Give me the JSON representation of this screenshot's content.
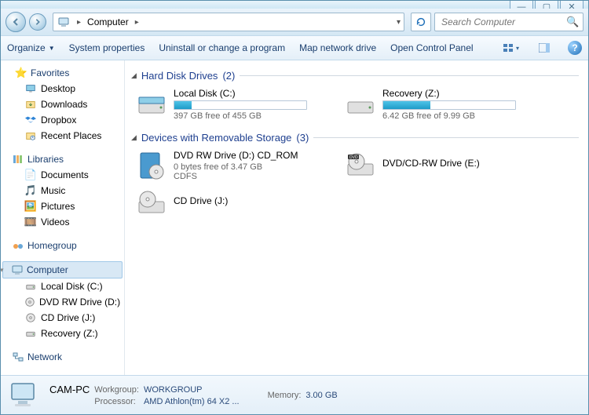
{
  "titlebar": {
    "min": "—",
    "max": "▢",
    "close": "✕"
  },
  "nav": {
    "location": "Computer",
    "search_placeholder": "Search Computer"
  },
  "toolbar": {
    "organize": "Organize",
    "sysprops": "System properties",
    "uninstall": "Uninstall or change a program",
    "mapdrive": "Map network drive",
    "controlpanel": "Open Control Panel"
  },
  "sidebar": {
    "favorites": {
      "label": "Favorites",
      "items": [
        {
          "label": "Desktop",
          "icon": "desktop"
        },
        {
          "label": "Downloads",
          "icon": "downloads"
        },
        {
          "label": "Dropbox",
          "icon": "dropbox"
        },
        {
          "label": "Recent Places",
          "icon": "recent"
        }
      ]
    },
    "libraries": {
      "label": "Libraries",
      "items": [
        {
          "label": "Documents",
          "icon": "doc"
        },
        {
          "label": "Music",
          "icon": "music"
        },
        {
          "label": "Pictures",
          "icon": "pic"
        },
        {
          "label": "Videos",
          "icon": "video"
        }
      ]
    },
    "homegroup": {
      "label": "Homegroup"
    },
    "computer": {
      "label": "Computer",
      "items": [
        {
          "label": "Local Disk (C:)",
          "icon": "hdd"
        },
        {
          "label": "DVD RW Drive (D:)",
          "icon": "dvd"
        },
        {
          "label": "CD Drive (J:)",
          "icon": "cd"
        },
        {
          "label": "Recovery (Z:)",
          "icon": "hdd"
        }
      ]
    },
    "network": {
      "label": "Network"
    }
  },
  "categories": {
    "hdd": {
      "label": "Hard Disk Drives",
      "count": "(2)"
    },
    "removable": {
      "label": "Devices with Removable Storage",
      "count": "(3)"
    }
  },
  "drives": {
    "local_c": {
      "name": "Local Disk (C:)",
      "free": "397 GB free of 455 GB",
      "pct": 13
    },
    "recovery_z": {
      "name": "Recovery (Z:)",
      "free": "6.42 GB free of 9.99 GB",
      "pct": 36
    },
    "dvd_d": {
      "name": "DVD RW Drive (D:) CD_ROM",
      "free": "0 bytes free of 3.47 GB",
      "fs": "CDFS"
    },
    "dvdcd_e": {
      "name": "DVD/CD-RW Drive (E:)"
    },
    "cd_j": {
      "name": "CD Drive (J:)"
    }
  },
  "details": {
    "name": "CAM-PC",
    "workgroup_label": "Workgroup:",
    "workgroup": "WORKGROUP",
    "memory_label": "Memory:",
    "memory": "3.00 GB",
    "processor_label": "Processor:",
    "processor": "AMD Athlon(tm) 64 X2 ..."
  }
}
